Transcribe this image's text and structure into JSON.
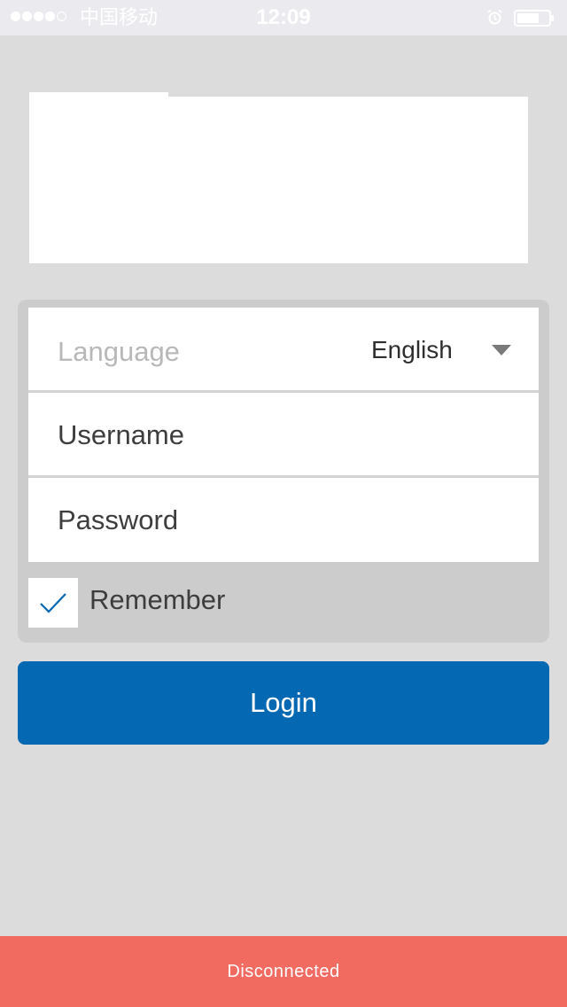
{
  "status_bar": {
    "carrier": "中国移动",
    "time": "12:09",
    "signal_bars_filled": 4,
    "signal_bars_total": 5,
    "icons": [
      "alarm-icon",
      "battery-icon"
    ]
  },
  "form": {
    "language_label": "Language",
    "language_value": "English",
    "username_placeholder": "Username",
    "password_placeholder": "Password",
    "remember_label": "Remember",
    "remember_checked": true
  },
  "login_button": {
    "label": "Login"
  },
  "connection_banner": {
    "text": "Disconnected"
  },
  "colors": {
    "background": "#dcdcdc",
    "panel": "#cccccc",
    "primary": "#0568b3",
    "error_banner": "#f16b61",
    "placeholder_text": "#b8b8b8"
  }
}
